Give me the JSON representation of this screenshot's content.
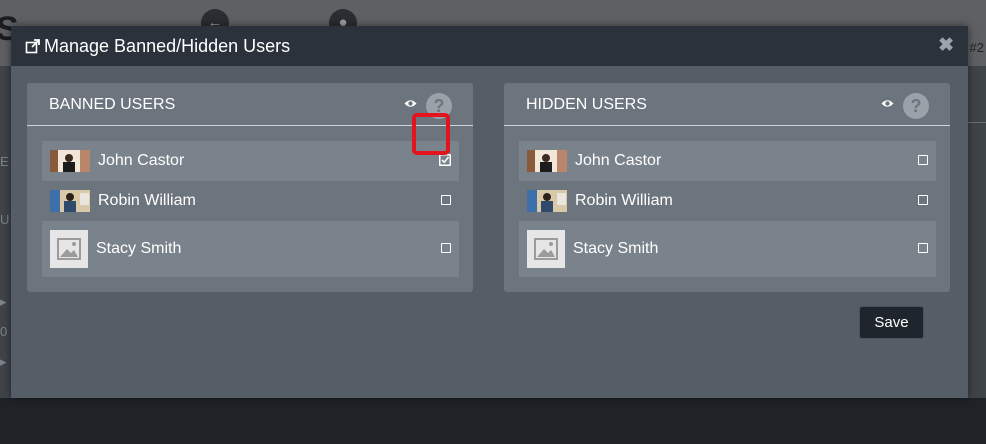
{
  "background": {
    "logo_fragment": "S",
    "hash_fragment": "#2",
    "side_fragments": [
      "E",
      "U",
      "▸",
      "0",
      "▸"
    ]
  },
  "modal": {
    "title": "Manage Banned/Hidden Users",
    "close_glyph": "✖",
    "save_label": "Save"
  },
  "panels": [
    {
      "title": "BANNED USERS",
      "users": [
        {
          "name": "John Castor",
          "checked": true
        },
        {
          "name": "Robin William",
          "checked": false
        },
        {
          "name": "Stacy Smith",
          "checked": false
        }
      ]
    },
    {
      "title": "HIDDEN USERS",
      "users": [
        {
          "name": "John Castor",
          "checked": false
        },
        {
          "name": "Robin William",
          "checked": false
        },
        {
          "name": "Stacy Smith",
          "checked": false
        }
      ]
    }
  ],
  "icons": {
    "help_glyph": "?",
    "external_link": "external-link-icon",
    "eye": "eye-icon"
  },
  "colors": {
    "highlight": "#e3141e",
    "modal_header": "#2b323b",
    "panel": "#6c747e"
  }
}
